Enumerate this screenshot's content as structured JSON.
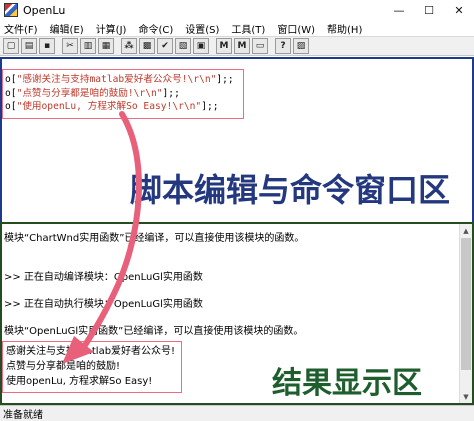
{
  "window": {
    "title": "OpenLu",
    "minimize": "—",
    "maximize": "☐",
    "close": "✕"
  },
  "menu": [
    "文件(F)",
    "编辑(E)",
    "计算(J)",
    "命令(C)",
    "设置(S)",
    "工具(T)",
    "窗口(W)",
    "帮助(H)"
  ],
  "toolbar": {
    "buttons": [
      "new",
      "open",
      "save",
      "cut",
      "copy",
      "paste",
      "run",
      "compile",
      "check",
      "find",
      "stop",
      "m1",
      "m2",
      "window",
      "help",
      "about"
    ],
    "glyphs": [
      "▢",
      "▤",
      "▪",
      "✂",
      "▥",
      "▦",
      "⁂",
      "▩",
      "✔",
      "▧",
      "▣",
      "M",
      "M",
      "▭",
      "?",
      "▨"
    ]
  },
  "editor": {
    "code": [
      {
        "prefix": "o[",
        "text": "\"感谢关注与支持matlab爱好者公众号!\\r\\n\"",
        "suffix": "];;"
      },
      {
        "prefix": "o[",
        "text": "\"点赞与分享都是咱的鼓励!\\r\\n\"",
        "suffix": "];;"
      },
      {
        "prefix": "o[",
        "text": "\"使用openLu, 方程求解So Easy!\\r\\n\"",
        "suffix": "];;"
      }
    ],
    "zone_label": "脚本编辑与命令窗口区"
  },
  "result": {
    "lines": [
      "模块“ChartWnd实用函数”已经编译，可以直接使用该模块的函数。",
      ">> 正在自动编译模块：OpenLuGl实用函数",
      ">> 正在自动执行模块：OpenLuGl实用函数",
      "模块“OpenLuGl实用函数”已经编译，可以直接使用该模块的函数。"
    ],
    "output": [
      "感谢关注与支持matlab爱好者公众号!",
      "点赞与分享都是咱的鼓励!",
      "使用openLu, 方程求解So Easy!"
    ],
    "zone_label": "结果显示区"
  },
  "status": {
    "text": "准备就绪"
  },
  "colors": {
    "editor_border": "#1e3a8a",
    "result_border": "#244e1f",
    "highlight_box": "#ee6a85",
    "arrow": "#e8607a"
  }
}
